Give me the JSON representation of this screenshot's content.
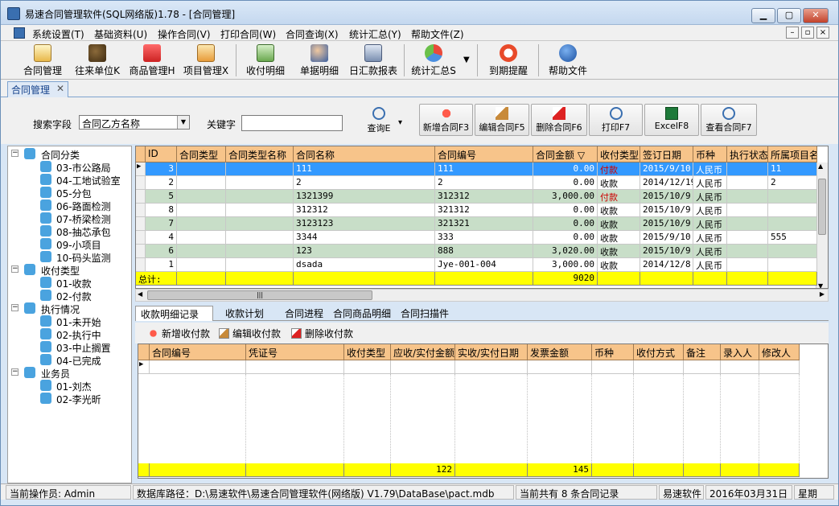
{
  "window": {
    "title": "易速合同管理软件(SQL网络版)1.78 - [合同管理]",
    "min_label": "▁",
    "max_label": "▢",
    "close_label": "✕"
  },
  "menu": [
    "系统设置(T)",
    "基础资料(U)",
    "操作合同(V)",
    "打印合同(W)",
    "合同查询(X)",
    "统计汇总(Y)",
    "帮助文件(Z)"
  ],
  "mdi_buttons": [
    "–",
    "▫",
    "×"
  ],
  "toolbar": {
    "items": [
      "合同管理",
      "往来单位K",
      "商品管理H",
      "项目管理X",
      "收付明细",
      "单据明细",
      "日汇款报表",
      "统计汇总S",
      "到期提醒",
      "帮助文件"
    ],
    "dropdown_arrow": "▼"
  },
  "doc_tab": {
    "label": "合同管理",
    "close": "✕"
  },
  "search": {
    "field_label": "搜索字段",
    "field_value": "合同乙方名称",
    "keyword_label": "关键字",
    "keyword_value": "",
    "query_label": "查询E",
    "query_arrow": "▾"
  },
  "actions": [
    "新增合同F3",
    "编辑合同F5",
    "删除合同F6",
    "打印F7",
    "ExcelF8",
    "查看合同F7"
  ],
  "tree": {
    "expander": "−",
    "groups": [
      {
        "label": "合同分类",
        "items": [
          "03-市公路局",
          "04-工地试验室",
          "05-分包",
          "06-路面检测",
          "07-桥梁检测",
          "08-抽芯承包",
          "09-小项目",
          "10-码头监测"
        ]
      },
      {
        "label": "收付类型",
        "items": [
          "01-收款",
          "02-付款"
        ]
      },
      {
        "label": "执行情况",
        "items": [
          "01-未开始",
          "02-执行中",
          "03-中止搁置",
          "04-已完成"
        ]
      },
      {
        "label": "业务员",
        "items": [
          "01-刘杰",
          "02-李光昕"
        ]
      }
    ]
  },
  "contracts_grid": {
    "headers": [
      "ID",
      "合同类型",
      "合同类型名称",
      "合同名称",
      "合同编号",
      "合同金额 ▽",
      "收付类型",
      "签订日期",
      "币种",
      "执行状态",
      "所属项目名"
    ],
    "rows": [
      {
        "id": "3",
        "type": "",
        "type_name": "",
        "name": "111",
        "code": "111",
        "amount": "0.00",
        "pay_type": "付款",
        "date": "2015/9/10",
        "currency": "人民币",
        "status": "",
        "project": "11"
      },
      {
        "id": "2",
        "type": "",
        "type_name": "",
        "name": "2",
        "code": "2",
        "amount": "0.00",
        "pay_type": "收款",
        "date": "2014/12/19",
        "currency": "人民币",
        "status": "",
        "project": "2"
      },
      {
        "id": "5",
        "type": "",
        "type_name": "",
        "name": "1321399",
        "code": "312312",
        "amount": "3,000.00",
        "pay_type": "付款",
        "date": "2015/10/9",
        "currency": "人民币",
        "status": "",
        "project": ""
      },
      {
        "id": "8",
        "type": "",
        "type_name": "",
        "name": "312312",
        "code": "321312",
        "amount": "0.00",
        "pay_type": "收款",
        "date": "2015/10/9",
        "currency": "人民币",
        "status": "",
        "project": ""
      },
      {
        "id": "7",
        "type": "",
        "type_name": "",
        "name": "3123123",
        "code": "321321",
        "amount": "0.00",
        "pay_type": "收款",
        "date": "2015/10/9",
        "currency": "人民币",
        "status": "",
        "project": ""
      },
      {
        "id": "4",
        "type": "",
        "type_name": "",
        "name": "3344",
        "code": "333",
        "amount": "0.00",
        "pay_type": "收款",
        "date": "2015/9/10",
        "currency": "人民币",
        "status": "",
        "project": "555"
      },
      {
        "id": "6",
        "type": "",
        "type_name": "",
        "name": "123",
        "code": "888",
        "amount": "3,020.00",
        "pay_type": "收款",
        "date": "2015/10/9",
        "currency": "人民币",
        "status": "",
        "project": ""
      },
      {
        "id": "1",
        "type": "",
        "type_name": "",
        "name": "dsada",
        "code": "Jye-001-004",
        "amount": "3,000.00",
        "pay_type": "收款",
        "date": "2014/12/8",
        "currency": "人民币",
        "status": "",
        "project": ""
      }
    ],
    "total_label": "总计:",
    "total_amount": "9020",
    "row_indicator": "▶"
  },
  "scroll": {
    "up": "▲",
    "down": "▼",
    "left": "◀",
    "right": "▶",
    "grip": "|||"
  },
  "sub_tabs": [
    "收款明细记录",
    "收款计划",
    "合同进程",
    "合同商品明细",
    "合同扫描件"
  ],
  "sub_toolbar": [
    "新增收付款",
    "编辑收付款",
    "删除收付款"
  ],
  "payments_grid": {
    "headers": [
      "合同编号",
      "凭证号",
      "收付类型",
      "应收/实付金额",
      "实收/实付日期",
      "发票金额",
      "币种",
      "收付方式",
      "备注",
      "录入人",
      "修改人"
    ],
    "totals": {
      "amount": "122",
      "invoice": "145"
    },
    "row_indicator": "▶"
  },
  "status": [
    "当前操作员: Admin",
    "数据库路径：D:\\易速软件\\易速合同管理软件(网络版) V1.79\\DataBase\\pact.mdb",
    "当前共有 8 条合同记录",
    "易速软件",
    "2016年03月31日",
    "星期"
  ],
  "colors": {
    "header_bg": "#f7c48a",
    "row_selected": "#3399ff",
    "row_alt": "#c8dec8",
    "total_bg": "#ffff00",
    "pay_red": "#cc0000"
  }
}
